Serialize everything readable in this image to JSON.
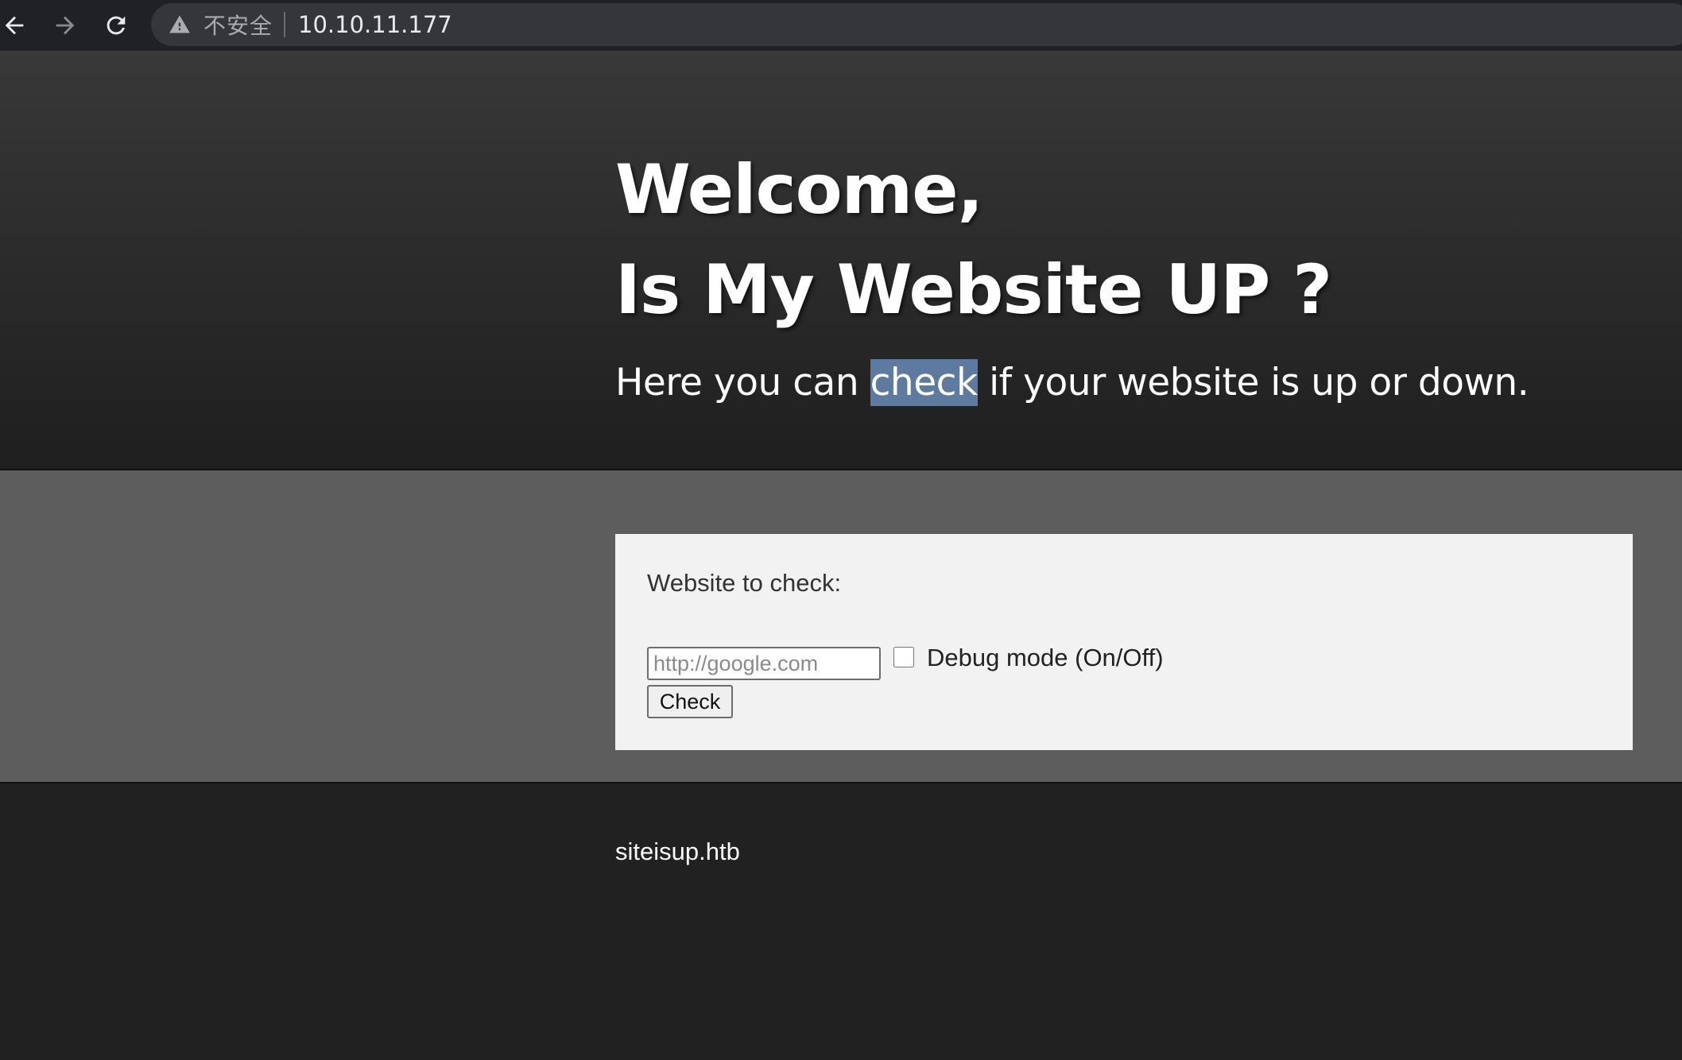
{
  "browser": {
    "back_icon": "arrow-left-icon",
    "forward_icon": "arrow-right-icon",
    "reload_icon": "reload-icon",
    "security_icon": "warning-triangle-icon",
    "security_label": "不安全",
    "url": "10.10.11.177"
  },
  "hero": {
    "title_line1": "Welcome,",
    "title_line2": "Is My Website UP ?",
    "subtitle_before": "Here you can ",
    "subtitle_highlight": "check",
    "subtitle_after": " if your website is up or down."
  },
  "form": {
    "label": "Website to check:",
    "url_placeholder": "http://google.com",
    "url_value": "",
    "debug_label": "Debug mode (On/Off)",
    "debug_checked": false,
    "submit_label": "Check"
  },
  "footer": {
    "text": "siteisup.htb"
  },
  "colors": {
    "hero_bg_top": "#383838",
    "form_band_bg": "#5e5d5e",
    "form_card_bg": "#f2f2f2",
    "footer_bg": "#212121",
    "selection_highlight": "#5d7aa0"
  }
}
